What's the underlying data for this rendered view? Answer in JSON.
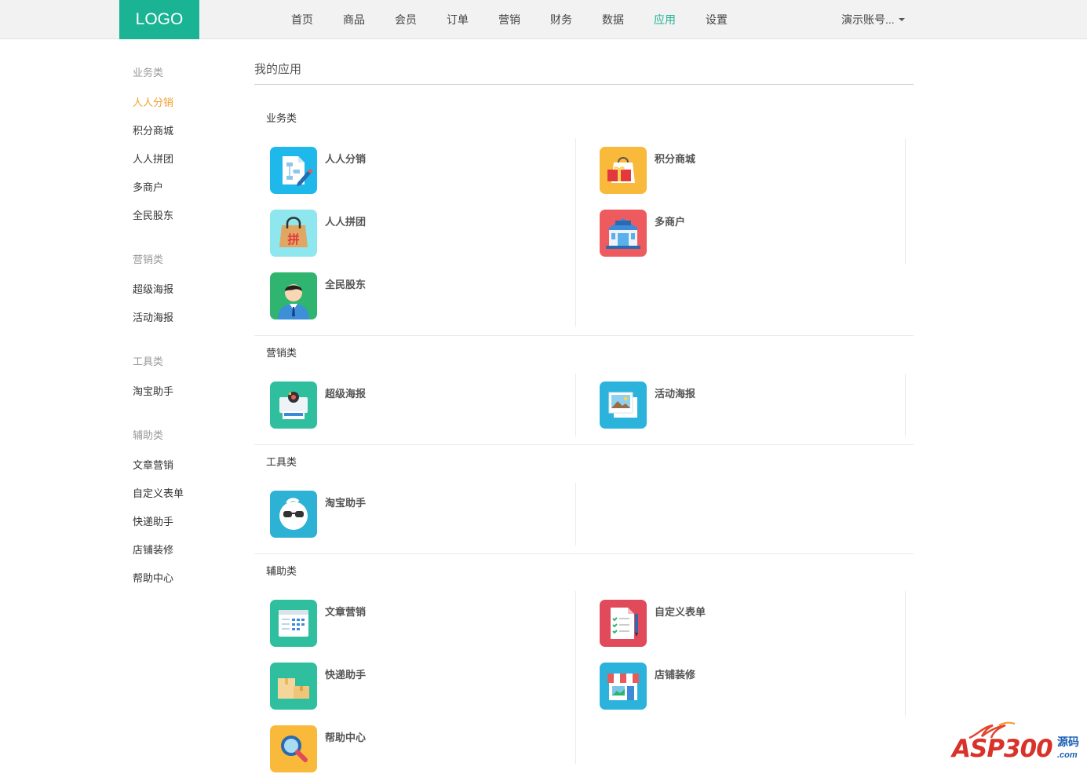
{
  "header": {
    "logo": "LOGO",
    "nav": [
      {
        "label": "首页",
        "active": false
      },
      {
        "label": "商品",
        "active": false
      },
      {
        "label": "会员",
        "active": false
      },
      {
        "label": "订单",
        "active": false
      },
      {
        "label": "营销",
        "active": false
      },
      {
        "label": "财务",
        "active": false
      },
      {
        "label": "数据",
        "active": false
      },
      {
        "label": "应用",
        "active": true
      },
      {
        "label": "设置",
        "active": false
      }
    ],
    "account": "演示账号...",
    "accent_color": "#1ab394"
  },
  "sidebar": {
    "active_color": "#f0a030",
    "groups": [
      {
        "title": "业务类",
        "items": [
          "人人分销",
          "积分商城",
          "人人拼团",
          "多商户",
          "全民股东"
        ]
      },
      {
        "title": "营销类",
        "items": [
          "超级海报",
          "活动海报"
        ]
      },
      {
        "title": "工具类",
        "items": [
          "淘宝助手"
        ]
      },
      {
        "title": "辅助类",
        "items": [
          "文章营销",
          "自定义表单",
          "快递助手",
          "店铺装修",
          "帮助中心"
        ]
      }
    ]
  },
  "main": {
    "title": "我的应用",
    "sections": [
      {
        "title": "业务类",
        "apps": [
          {
            "name": "人人分销",
            "icon": "flowchart-pen-icon"
          },
          {
            "name": "积分商城",
            "icon": "gift-bag-icon"
          },
          {
            "name": "人人拼团",
            "icon": "shopping-bag-icon"
          },
          {
            "name": "多商户",
            "icon": "storefront-icon"
          },
          {
            "name": "全民股东",
            "icon": "businessman-icon"
          }
        ]
      },
      {
        "title": "营销类",
        "apps": [
          {
            "name": "超级海报",
            "icon": "printer-poster-icon"
          },
          {
            "name": "活动海报",
            "icon": "photo-frame-icon"
          }
        ]
      },
      {
        "title": "工具类",
        "apps": [
          {
            "name": "淘宝助手",
            "icon": "glasses-face-icon"
          }
        ]
      },
      {
        "title": "辅助类",
        "apps": [
          {
            "name": "文章营销",
            "icon": "calendar-grid-icon"
          },
          {
            "name": "自定义表单",
            "icon": "checklist-form-icon"
          },
          {
            "name": "快递助手",
            "icon": "parcel-boxes-icon"
          },
          {
            "name": "店铺装修",
            "icon": "shop-awning-icon"
          },
          {
            "name": "帮助中心",
            "icon": "magnifier-icon"
          }
        ]
      }
    ]
  },
  "watermark": {
    "main": "ASP300",
    "side": "源码",
    "suffix": ".com"
  }
}
